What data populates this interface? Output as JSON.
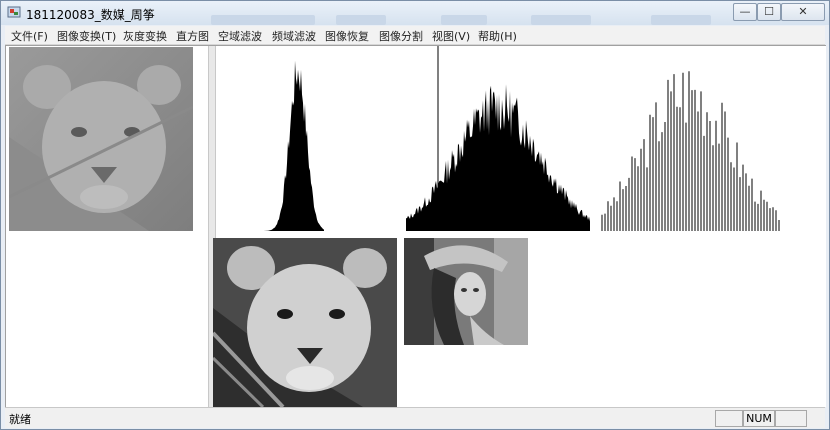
{
  "window": {
    "title": "181120083_数媒_周筝"
  },
  "controls": {
    "minimize": "—",
    "maximize": "☐",
    "close": "✕"
  },
  "menu": [
    {
      "label": "文件(F)"
    },
    {
      "label": "图像变换(T)"
    },
    {
      "label": "灰度变换"
    },
    {
      "label": "直方图"
    },
    {
      "label": "空域滤波"
    },
    {
      "label": "频域滤波"
    },
    {
      "label": "图像恢复"
    },
    {
      "label": "图像分割"
    },
    {
      "label": "视图(V)"
    },
    {
      "label": "帮助(H)"
    }
  ],
  "images": {
    "original": "low-contrast lion cub photo",
    "result": "contrast-enhanced lion cub photo",
    "reference": "lena grayscale photo"
  },
  "status": {
    "text": "就绪",
    "num": "NUM"
  }
}
